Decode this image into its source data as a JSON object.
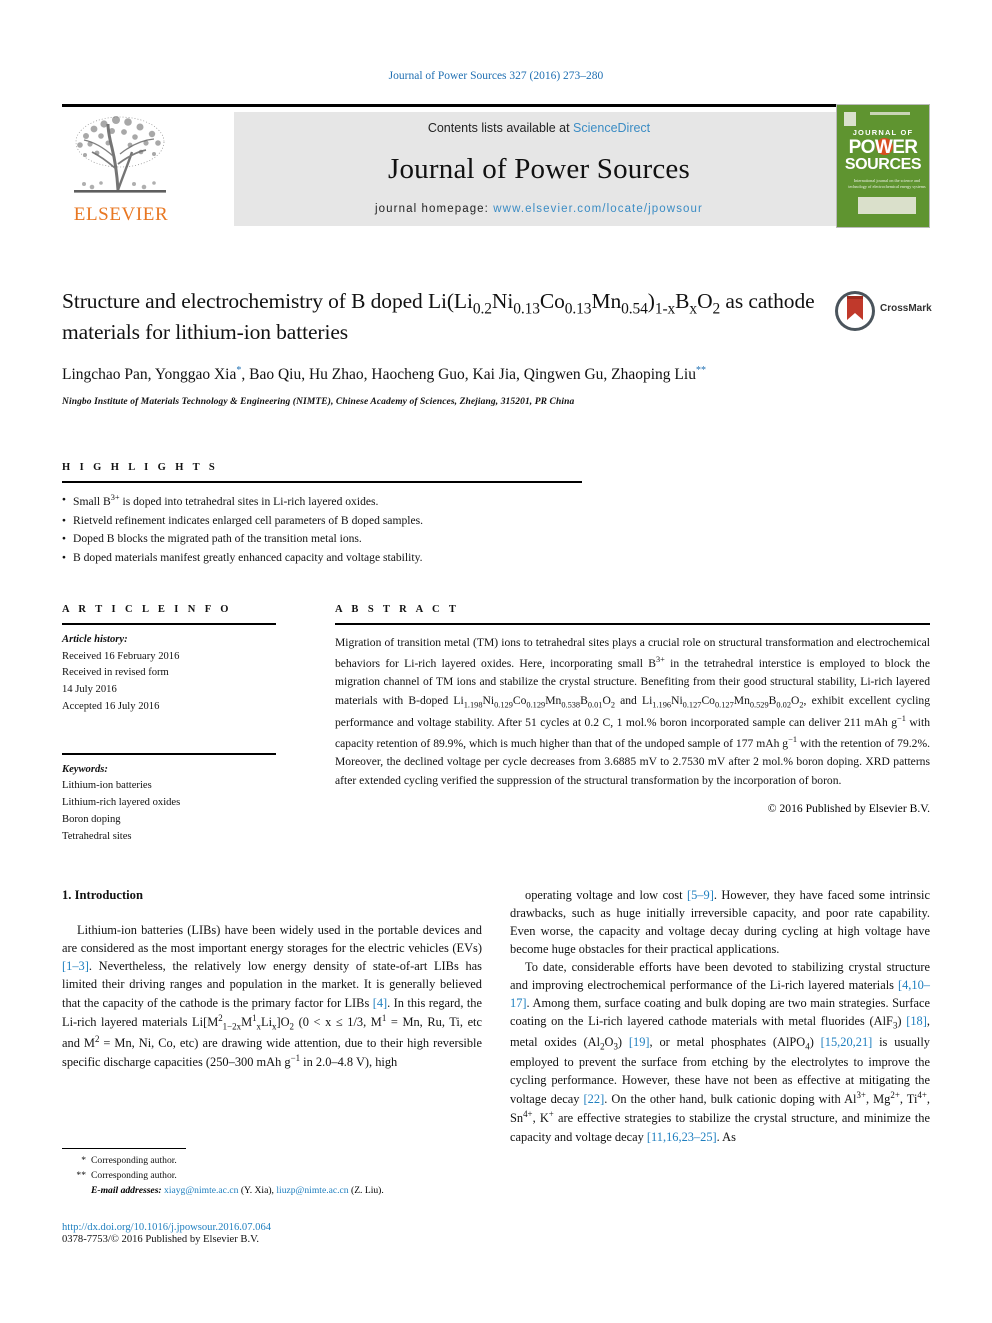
{
  "running_head": "Journal of Power Sources 327 (2016) 273–280",
  "masthead": {
    "contents_prefix": "Contents lists available at ",
    "contents_link": "ScienceDirect",
    "journal_title": "Journal of Power Sources",
    "homepage_prefix": "journal homepage: ",
    "homepage_url": "www.elsevier.com/locate/jpowsour",
    "publisher": "ELSEVIER",
    "cover": {
      "line1": "JOURNAL OF",
      "line2": "POWER",
      "line3": "SOURCES",
      "blurb": "International journal on the science and technology of electrochemical energy systems"
    }
  },
  "article": {
    "title_html": "Structure and electrochemistry of B doped Li(Li<sub>0.2</sub>Ni<sub>0.13</sub>Co<sub>0.13</sub>Mn<sub>0.54</sub>)<sub>1-</sub><sub>x</sub>B<sub>x</sub>O<sub>2</sub> as cathode materials for lithium-ion batteries",
    "crossmark_label": "CrossMark",
    "authors_html": "Lingchao Pan, Yonggao Xia<sup>*</sup>, Bao Qiu, Hu Zhao, Haocheng Guo, Kai Jia, Qingwen Gu, Zhaoping Liu<sup>**</sup>",
    "affiliation": "Ningbo Institute of Materials Technology & Engineering (NIMTE), Chinese Academy of Sciences, Zhejiang, 315201, PR China"
  },
  "highlights": {
    "label": "H I G H L I G H T S",
    "items_html": [
      "Small B<sup>3+</sup> is doped into tetrahedral sites in Li-rich layered oxides.",
      "Rietveld refinement indicates enlarged cell parameters of B doped samples.",
      "Doped B blocks the migrated path of the transition metal ions.",
      "B doped materials manifest greatly enhanced capacity and voltage stability."
    ]
  },
  "article_info": {
    "label": "A R T I C L E  I N F O",
    "history_label": "Article history:",
    "history_lines": [
      "Received 16 February 2016",
      "Received in revised form",
      "14 July 2016",
      "Accepted 16 July 2016"
    ],
    "keywords_label": "Keywords:",
    "keywords": [
      "Lithium-ion batteries",
      "Lithium-rich layered oxides",
      "Boron doping",
      "Tetrahedral sites"
    ]
  },
  "abstract": {
    "label": "A B S T R A C T",
    "body_html": "Migration of transition metal (TM) ions to tetrahedral sites plays a crucial role on structural transformation and electrochemical behaviors for Li-rich layered oxides. Here, incorporating small B<sup>3+</sup> in the tetrahedral interstice is employed to block the migration channel of TM ions and stabilize the crystal structure. Benefiting from their good structural stability, Li-rich layered materials with B-doped Li<sub>1.198</sub>Ni<sub>0.129</sub>Co<sub>0.129</sub>Mn<sub>0.538</sub>B<sub>0.01</sub>O<sub>2</sub> and Li<sub>1.196</sub>Ni<sub>0.127</sub>Co<sub>0.127</sub>Mn<sub>0.529</sub>B<sub>0.02</sub>O<sub>2</sub>, exhibit excellent cycling performance and voltage stability. After 51 cycles at 0.2 C, 1 mol.% boron incorporated sample can deliver 211 mAh g<sup>−1</sup> with capacity retention of 89.9%, which is much higher than that of the undoped sample of 177 mAh g<sup>−1</sup> with the retention of 79.2%. Moreover, the declined voltage per cycle decreases from 3.6885 mV to 2.7530 mV after 2 mol.% boron doping. XRD patterns after extended cycling verified the suppression of the structural transformation by the incorporation of boron.",
    "copyright": "© 2016 Published by Elsevier B.V."
  },
  "body": {
    "section_number_title": "1. Introduction",
    "left_paragraphs_html": [
      "Lithium-ion batteries (LIBs) have been widely used in the portable devices and are considered as the most important energy storages for the electric vehicles (EVs) <span class=\"ref\">[1–3]</span>. Nevertheless, the relatively low energy density of state-of-art LIBs has limited their driving ranges and population in the market. It is generally believed that the capacity of the cathode is the primary factor for LIBs <span class=\"ref\">[4]</span>. In this regard, the Li-rich layered materials Li[M<sup>2</sup><sub>1−2x</sub>M<sup>1</sup><sub>x</sub>Li<sub>x</sub>]O<sub>2</sub> (0 &lt; x ≤ 1/3, M<sup>1</sup> = Mn, Ru, Ti, etc and M<sup>2</sup> = Mn, Ni, Co, etc) are drawing wide attention, due to their high reversible specific discharge capacities (250–300 mAh g<sup>−1</sup> in 2.0–4.8 V), high"
    ],
    "right_paragraphs_html": [
      "operating voltage and low cost <span class=\"ref\">[5–9]</span>. However, they have faced some intrinsic drawbacks, such as huge initially irreversible capacity, and poor rate capability. Even worse, the capacity and voltage decay during cycling at high voltage have become huge obstacles for their practical applications.",
      "To date, considerable efforts have been devoted to stabilizing crystal structure and improving electrochemical performance of the Li-rich layered materials <span class=\"ref\">[4,10–17]</span>. Among them, surface coating and bulk doping are two main strategies. Surface coating on the Li-rich layered cathode materials with metal fluorides (AlF<sub>3</sub>) <span class=\"ref\">[18]</span>, metal oxides (Al<sub>2</sub>O<sub>3</sub>) <span class=\"ref\">[19]</span>, or metal phosphates (AlPO<sub>4</sub>) <span class=\"ref\">[15,20,21]</span> is usually employed to prevent the surface from etching by the electrolytes to improve the cycling performance. However, these have not been as effective at mitigating the voltage decay <span class=\"ref\">[22]</span>. On the other hand, bulk cationic doping with Al<sup>3+</sup>, Mg<sup>2+</sup>, Ti<sup>4+</sup>, Sn<sup>4+</sup>, K<sup>+</sup> are effective strategies to stabilize the crystal structure, and minimize the capacity and voltage decay <span class=\"ref\">[11,16,23–25]</span>. As"
    ]
  },
  "footnotes": {
    "line1_star": "*",
    "line1_text": "Corresponding author.",
    "line2_star": "**",
    "line2_text": "Corresponding author.",
    "email_label": "E-mail addresses:",
    "email1": "xiayg@nimte.ac.cn",
    "email1_who": "(Y. Xia),",
    "email2": "liuzp@nimte.ac.cn",
    "email2_who": "(Z. Liu)."
  },
  "footer": {
    "doi": "http://dx.doi.org/10.1016/j.jpowsour.2016.07.064",
    "issn": "0378-7753/© 2016 Published by Elsevier B.V."
  },
  "colors": {
    "link": "#1f7fbf",
    "elsevier_orange": "#E87722",
    "cover_green": "#5f9430",
    "masthead_grey": "#e6e6e6"
  }
}
